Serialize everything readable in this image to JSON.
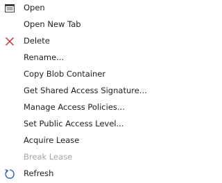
{
  "menu": {
    "items": [
      {
        "label": "Open",
        "icon": "window-icon",
        "enabled": true
      },
      {
        "label": "Open New Tab",
        "icon": "",
        "enabled": true
      },
      {
        "label": "Delete",
        "icon": "close-x-icon",
        "enabled": true
      },
      {
        "label": "Rename...",
        "icon": "",
        "enabled": true
      },
      {
        "label": "Copy Blob Container",
        "icon": "",
        "enabled": true
      },
      {
        "label": "Get Shared Access Signature...",
        "icon": "",
        "enabled": true
      },
      {
        "label": "Manage Access Policies...",
        "icon": "",
        "enabled": true
      },
      {
        "label": "Set Public Access Level...",
        "icon": "",
        "enabled": true
      },
      {
        "label": "Acquire Lease",
        "icon": "",
        "enabled": true
      },
      {
        "label": "Break Lease",
        "icon": "",
        "enabled": false
      },
      {
        "label": "Refresh",
        "icon": "refresh-icon",
        "enabled": true
      }
    ]
  },
  "colors": {
    "text": "#1e1e1e",
    "disabled_text": "#a6a6a6",
    "delete_icon": "#c5282e",
    "refresh_icon": "#2a65b3",
    "window_icon": "#3c3c3c"
  }
}
